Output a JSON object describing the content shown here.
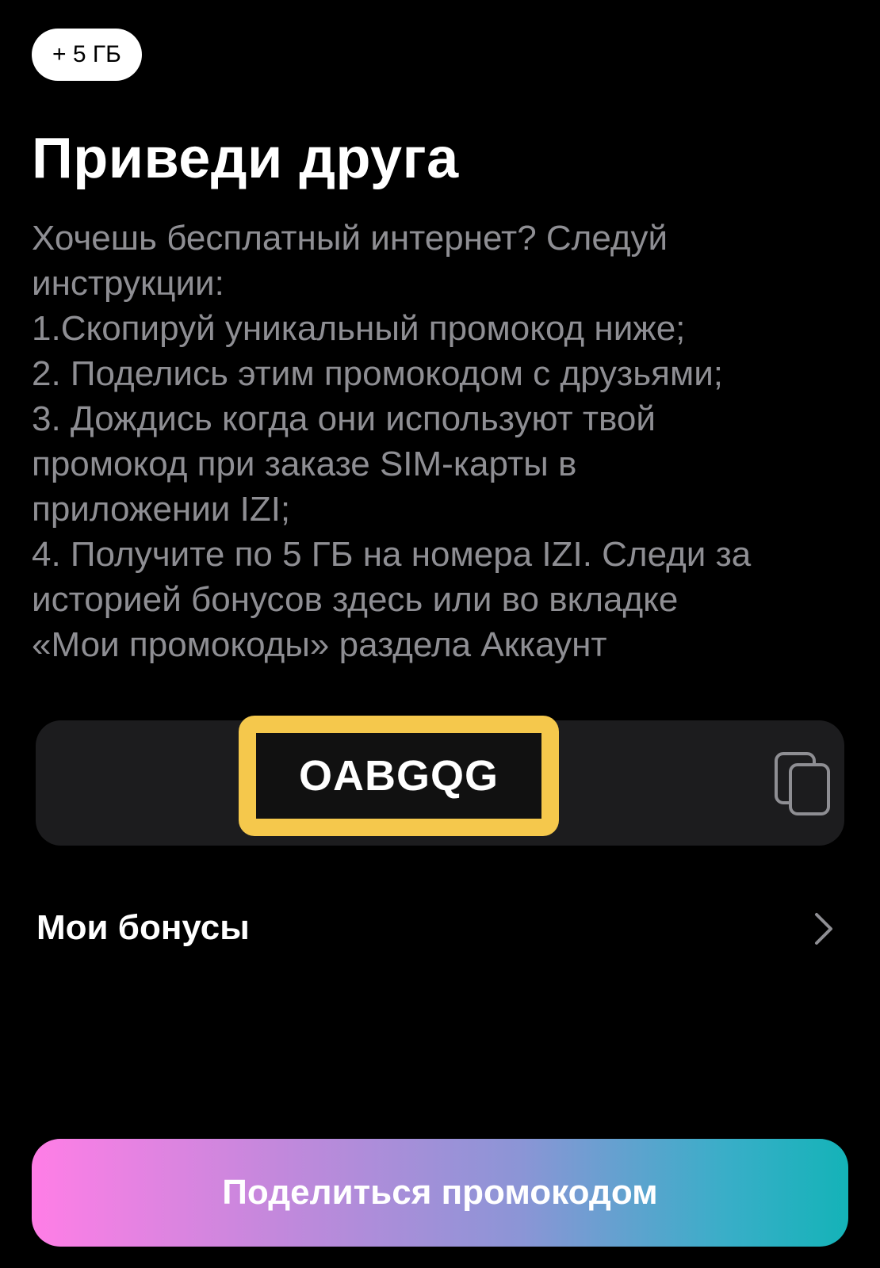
{
  "badge": {
    "label": "+ 5 ГБ"
  },
  "header": {
    "title": "Приведи друга"
  },
  "description": {
    "lines": [
      "Хочешь бесплатный интернет? Следуй",
      "инструкции:",
      "1.Скопируй уникальный промокод ниже;",
      "2. Поделись этим промокодом с друзьями;",
      "3. Дождись когда они используют твой",
      "промокод при заказе SIM-карты в",
      "приложении IZI;",
      "4. Получите по 5 ГБ на номера IZI. Следи за",
      "историей бонусов здесь или во вкладке",
      "«Мои промокоды» раздела Аккаунт"
    ]
  },
  "promo": {
    "code": "OABGQG",
    "copy_icon": "copy-icon",
    "highlight_color": "#f5c84c"
  },
  "bonuses": {
    "label": "Мои бонусы",
    "chevron_icon": "chevron-right-icon"
  },
  "share_button": {
    "label": "Поделиться промокодом"
  },
  "colors": {
    "background": "#000000",
    "text_primary": "#ffffff",
    "text_secondary": "#8e8e93",
    "card": "#1c1c1e",
    "gradient_start": "#ff7ee6",
    "gradient_end": "#14b3b8"
  }
}
